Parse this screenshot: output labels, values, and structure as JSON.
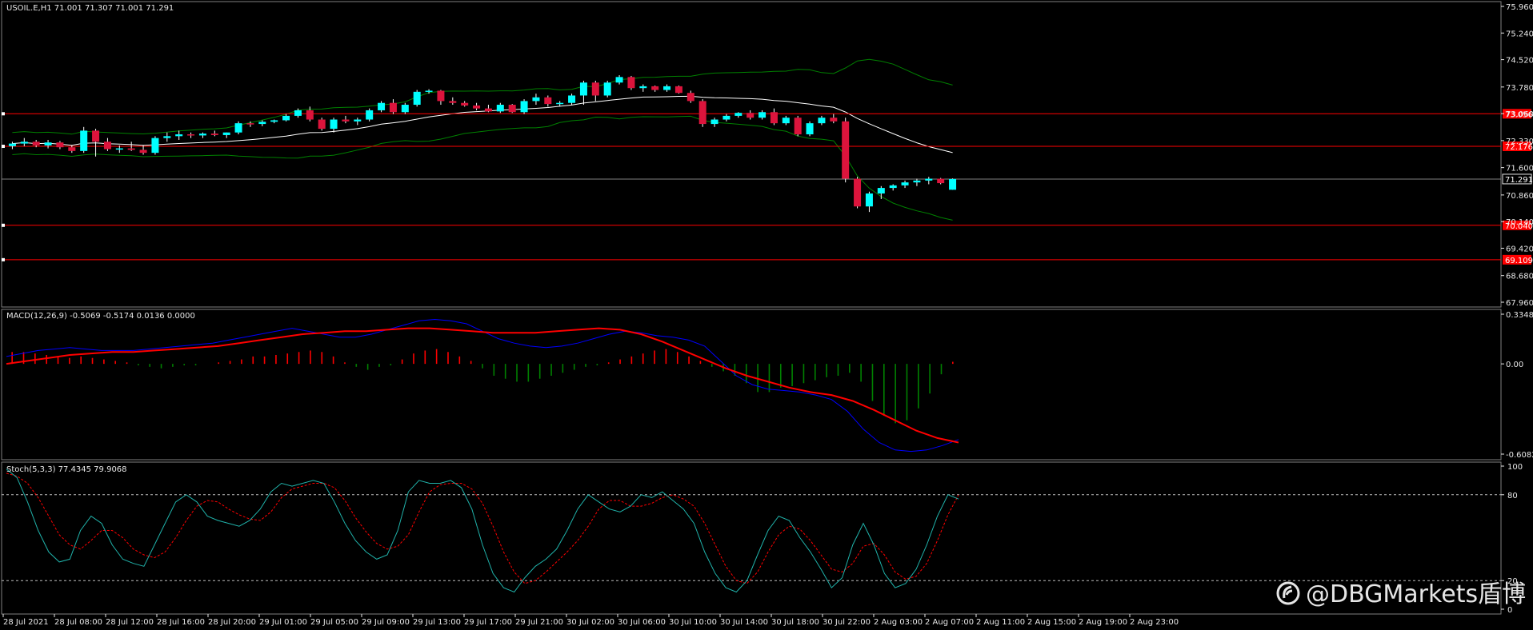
{
  "chart_data": [
    {
      "type": "candlestick",
      "panel": "price",
      "symbol_header": "USOIL.E,H1  71.001 71.307 71.001 71.291",
      "colors": {
        "bull": "#00ffff",
        "bear": "#dc143c",
        "ma": "#ffffff",
        "bands": "#008000",
        "hline": "#ff0000",
        "bid": "#808080"
      },
      "yticks": [
        "75.960",
        "75.240",
        "74.520",
        "73.780",
        "73.060",
        "72.330",
        "71.600",
        "70.860",
        "70.140",
        "69.420",
        "68.680",
        "67.960"
      ],
      "ylim": [
        67.96,
        75.96
      ],
      "last_price": "71.291",
      "hlines": [
        {
          "value": 73.056,
          "label": "73.056"
        },
        {
          "value": 72.176,
          "label": "72.176"
        },
        {
          "value": 70.04,
          "label": "70.040"
        },
        {
          "value": 69.109,
          "label": "69.109"
        }
      ],
      "candles": [
        [
          72.18,
          72.3,
          72.1,
          72.25
        ],
        [
          72.25,
          72.4,
          72.18,
          72.3
        ],
        [
          72.3,
          72.35,
          72.15,
          72.2
        ],
        [
          72.2,
          72.35,
          72.12,
          72.28
        ],
        [
          72.28,
          72.32,
          72.1,
          72.15
        ],
        [
          72.15,
          72.2,
          72.0,
          72.05
        ],
        [
          72.05,
          72.7,
          72.0,
          72.6
        ],
        [
          72.6,
          72.65,
          71.9,
          72.3
        ],
        [
          72.3,
          72.4,
          72.05,
          72.1
        ],
        [
          72.1,
          72.2,
          72.0,
          72.12
        ],
        [
          72.12,
          72.3,
          72.05,
          72.08
        ],
        [
          72.08,
          72.2,
          71.95,
          72.0
        ],
        [
          72.0,
          72.45,
          71.95,
          72.4
        ],
        [
          72.4,
          72.55,
          72.3,
          72.45
        ],
        [
          72.45,
          72.6,
          72.35,
          72.5
        ],
        [
          72.5,
          72.55,
          72.4,
          72.47
        ],
        [
          72.47,
          72.55,
          72.4,
          72.52
        ],
        [
          72.52,
          72.6,
          72.45,
          72.48
        ],
        [
          72.48,
          72.55,
          72.4,
          72.55
        ],
        [
          72.55,
          72.85,
          72.5,
          72.8
        ],
        [
          72.8,
          72.85,
          72.7,
          72.78
        ],
        [
          72.78,
          72.88,
          72.72,
          72.84
        ],
        [
          72.84,
          72.9,
          72.8,
          72.88
        ],
        [
          72.88,
          73.05,
          72.85,
          73.0
        ],
        [
          73.0,
          73.2,
          72.95,
          73.15
        ],
        [
          73.15,
          73.25,
          72.85,
          72.9
        ],
        [
          72.9,
          72.95,
          72.6,
          72.65
        ],
        [
          72.65,
          72.95,
          72.55,
          72.9
        ],
        [
          72.9,
          73.0,
          72.8,
          72.85
        ],
        [
          72.85,
          72.95,
          72.75,
          72.9
        ],
        [
          72.9,
          73.2,
          72.85,
          73.15
        ],
        [
          73.15,
          73.4,
          73.1,
          73.35
        ],
        [
          73.35,
          73.45,
          73.05,
          73.1
        ],
        [
          73.1,
          73.35,
          73.05,
          73.3
        ],
        [
          73.3,
          73.7,
          73.25,
          73.65
        ],
        [
          73.65,
          73.72,
          73.6,
          73.68
        ],
        [
          73.68,
          73.7,
          73.3,
          73.4
        ],
        [
          73.4,
          73.5,
          73.3,
          73.35
        ],
        [
          73.35,
          73.4,
          73.25,
          73.28
        ],
        [
          73.28,
          73.35,
          73.15,
          73.2
        ],
        [
          73.2,
          73.3,
          73.1,
          73.12
        ],
        [
          73.12,
          73.35,
          73.08,
          73.3
        ],
        [
          73.3,
          73.32,
          73.08,
          73.1
        ],
        [
          73.1,
          73.45,
          73.05,
          73.4
        ],
        [
          73.4,
          73.6,
          73.3,
          73.5
        ],
        [
          73.5,
          73.55,
          73.25,
          73.32
        ],
        [
          73.32,
          73.4,
          73.25,
          73.35
        ],
        [
          73.35,
          73.6,
          73.3,
          73.55
        ],
        [
          73.55,
          73.95,
          73.3,
          73.9
        ],
        [
          73.9,
          73.95,
          73.4,
          73.55
        ],
        [
          73.55,
          73.95,
          73.5,
          73.9
        ],
        [
          73.9,
          74.1,
          73.85,
          74.05
        ],
        [
          74.05,
          74.08,
          73.7,
          73.75
        ],
        [
          73.75,
          73.85,
          73.65,
          73.8
        ],
        [
          73.8,
          73.82,
          73.65,
          73.7
        ],
        [
          73.7,
          73.85,
          73.65,
          73.8
        ],
        [
          73.8,
          73.82,
          73.6,
          73.62
        ],
        [
          73.62,
          73.68,
          73.35,
          73.4
        ],
        [
          73.4,
          73.45,
          72.7,
          72.78
        ],
        [
          72.78,
          72.95,
          72.7,
          72.9
        ],
        [
          72.9,
          73.05,
          72.85,
          73.0
        ],
        [
          73.0,
          73.1,
          72.95,
          73.08
        ],
        [
          73.08,
          73.15,
          72.9,
          72.95
        ],
        [
          72.95,
          73.15,
          72.9,
          73.1
        ],
        [
          73.1,
          73.2,
          72.75,
          72.8
        ],
        [
          72.8,
          73.0,
          72.75,
          72.95
        ],
        [
          72.95,
          73.0,
          72.45,
          72.5
        ],
        [
          72.5,
          72.85,
          72.45,
          72.8
        ],
        [
          72.8,
          73.0,
          72.75,
          72.95
        ],
        [
          72.95,
          73.05,
          72.8,
          72.85
        ],
        [
          72.85,
          72.95,
          71.2,
          71.3
        ],
        [
          71.3,
          71.35,
          70.5,
          70.55
        ],
        [
          70.55,
          70.95,
          70.4,
          70.9
        ],
        [
          70.9,
          71.1,
          70.75,
          71.05
        ],
        [
          71.05,
          71.15,
          70.98,
          71.12
        ],
        [
          71.12,
          71.25,
          71.05,
          71.2
        ],
        [
          71.2,
          71.3,
          71.1,
          71.25
        ],
        [
          71.25,
          71.35,
          71.15,
          71.3
        ],
        [
          71.3,
          71.32,
          71.15,
          71.18
        ],
        [
          71.001,
          71.307,
          71.001,
          71.291
        ]
      ]
    },
    {
      "type": "macd",
      "panel": "macd",
      "label": "MACD(12,26,9) -0.5069 -0.5174 0.0136 0.0000",
      "yticks": [
        "0.3348",
        "0.00",
        "-0.6082"
      ],
      "ylim": [
        -0.6082,
        0.3348
      ],
      "colors": {
        "hist_pos": "#ff0000",
        "hist_neg": "#008000",
        "signal": "#ff0000",
        "macd": "#0000ff"
      },
      "histogram": [
        0.08,
        0.08,
        0.07,
        0.06,
        0.05,
        0.04,
        0.05,
        0.04,
        0.03,
        0.02,
        0.01,
        -0.01,
        -0.02,
        -0.03,
        -0.02,
        -0.01,
        -0.01,
        0.0,
        0.01,
        0.02,
        0.03,
        0.05,
        0.05,
        0.06,
        0.07,
        0.08,
        0.09,
        0.08,
        0.05,
        0.01,
        -0.02,
        -0.04,
        -0.02,
        -0.01,
        0.03,
        0.07,
        0.09,
        0.1,
        0.08,
        0.05,
        0.02,
        -0.03,
        -0.08,
        -0.1,
        -0.12,
        -0.12,
        -0.1,
        -0.08,
        -0.06,
        -0.04,
        -0.02,
        -0.01,
        0.01,
        0.03,
        0.05,
        0.07,
        0.09,
        0.1,
        0.08,
        0.05,
        0.02,
        -0.02,
        -0.05,
        -0.08,
        -0.13,
        -0.19,
        -0.19,
        -0.16,
        -0.15,
        -0.13,
        -0.11,
        -0.09,
        -0.08,
        -0.06,
        -0.12,
        -0.25,
        -0.35,
        -0.4,
        -0.38,
        -0.3,
        -0.2,
        -0.07,
        0.014
      ],
      "macd": [
        0.05,
        0.07,
        0.09,
        0.1,
        0.11,
        0.1,
        0.09,
        0.09,
        0.09,
        0.1,
        0.11,
        0.12,
        0.13,
        0.14,
        0.16,
        0.18,
        0.2,
        0.22,
        0.24,
        0.22,
        0.2,
        0.18,
        0.18,
        0.2,
        0.23,
        0.26,
        0.29,
        0.3,
        0.29,
        0.27,
        0.22,
        0.17,
        0.14,
        0.12,
        0.11,
        0.12,
        0.14,
        0.17,
        0.2,
        0.22,
        0.21,
        0.19,
        0.18,
        0.16,
        0.12,
        0.02,
        -0.08,
        -0.14,
        -0.17,
        -0.18,
        -0.19,
        -0.21,
        -0.24,
        -0.32,
        -0.44,
        -0.53,
        -0.58,
        -0.59,
        -0.58,
        -0.55,
        -0.51
      ],
      "signal": [
        0.0,
        0.02,
        0.04,
        0.06,
        0.07,
        0.08,
        0.08,
        0.09,
        0.1,
        0.11,
        0.12,
        0.14,
        0.16,
        0.18,
        0.2,
        0.21,
        0.22,
        0.22,
        0.23,
        0.24,
        0.24,
        0.23,
        0.22,
        0.21,
        0.21,
        0.21,
        0.22,
        0.23,
        0.24,
        0.23,
        0.2,
        0.15,
        0.09,
        0.03,
        -0.03,
        -0.08,
        -0.12,
        -0.16,
        -0.19,
        -0.21,
        -0.25,
        -0.31,
        -0.38,
        -0.45,
        -0.5,
        -0.53
      ]
    },
    {
      "type": "stochastic",
      "panel": "stoch",
      "label": "Stoch(5,3,3) 77.4345 79.9068",
      "yticks": [
        "100",
        "80",
        "20",
        "0"
      ],
      "ylim": [
        0,
        100
      ],
      "levels": [
        80,
        20
      ],
      "colors": {
        "main": "#20b2aa",
        "signal": "#ff0000"
      },
      "main": [
        98,
        92,
        75,
        55,
        40,
        33,
        35,
        55,
        65,
        60,
        45,
        35,
        32,
        30,
        45,
        60,
        75,
        80,
        75,
        65,
        62,
        60,
        58,
        62,
        70,
        82,
        88,
        86,
        88,
        90,
        88,
        75,
        60,
        48,
        40,
        35,
        38,
        55,
        82,
        90,
        88,
        88,
        90,
        85,
        70,
        45,
        25,
        15,
        12,
        22,
        30,
        35,
        42,
        55,
        70,
        80,
        75,
        70,
        68,
        72,
        80,
        78,
        82,
        76,
        70,
        60,
        40,
        25,
        15,
        12,
        20,
        38,
        55,
        65,
        62,
        50,
        40,
        28,
        15,
        22,
        45,
        60,
        45,
        25,
        15,
        18,
        28,
        45,
        65,
        80,
        77
      ],
      "signal": [
        95,
        93,
        88,
        78,
        65,
        52,
        45,
        42,
        48,
        55,
        55,
        50,
        42,
        38,
        36,
        40,
        50,
        62,
        72,
        76,
        75,
        70,
        66,
        63,
        62,
        68,
        78,
        84,
        86,
        88,
        88,
        85,
        76,
        64,
        54,
        46,
        42,
        44,
        52,
        68,
        82,
        87,
        88,
        88,
        84,
        74,
        58,
        40,
        26,
        18,
        20,
        26,
        33,
        40,
        48,
        58,
        70,
        76,
        76,
        72,
        72,
        74,
        78,
        80,
        77,
        72,
        60,
        45,
        30,
        20,
        18,
        26,
        40,
        52,
        58,
        56,
        48,
        38,
        28,
        26,
        32,
        44,
        46,
        38,
        26,
        21,
        23,
        32,
        48,
        66,
        79.9
      ]
    }
  ],
  "xaxis": {
    "labels": [
      "28 Jul 2021",
      "28 Jul 08:00",
      "28 Jul 12:00",
      "28 Jul 16:00",
      "28 Jul 20:00",
      "29 Jul 01:00",
      "29 Jul 05:00",
      "29 Jul 09:00",
      "29 Jul 13:00",
      "29 Jul 17:00",
      "29 Jul 21:00",
      "30 Jul 02:00",
      "30 Jul 06:00",
      "30 Jul 10:00",
      "30 Jul 14:00",
      "30 Jul 18:00",
      "30 Jul 22:00",
      "2 Aug 03:00",
      "2 Aug 07:00",
      "2 Aug 11:00",
      "2 Aug 15:00",
      "2 Aug 19:00",
      "2 Aug 23:00"
    ]
  },
  "watermark": {
    "logo_icon": "weibo-logo-icon",
    "text": "@DBGMarkets盾博"
  }
}
